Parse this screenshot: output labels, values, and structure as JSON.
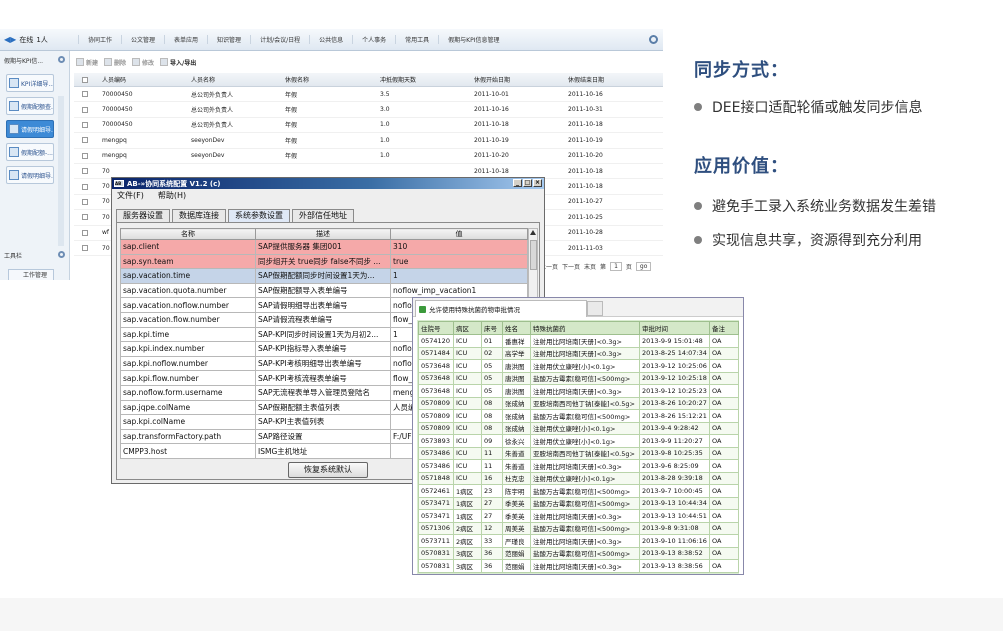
{
  "app": {
    "online_label": "在线",
    "online_count": "1人",
    "menu": [
      "协同工作",
      "公文管理",
      "表单应用",
      "知识管理",
      "计划/会议/日程",
      "公共信息",
      "个人事务",
      "常用工具",
      "假期与KPI信息管理"
    ],
    "sidebar_title": "假期与KPI信...",
    "sidebar_items": [
      "KPI详细导...",
      "假期配额查...",
      "请假明细导...",
      "假期配额-...",
      "请假明细导..."
    ],
    "sidebar_tool_title": "工具栏",
    "sidebar_work": "工作管理",
    "toolbar": [
      "新建",
      "删除",
      "修改",
      "导入/导出"
    ],
    "grid_headers": [
      "人员编码",
      "人员名称",
      "休假名称",
      "冲抵假期天数",
      "休假开始日期",
      "休假结束日期"
    ],
    "grid_rows": [
      [
        "70000450",
        "总公司外负责人",
        "年假",
        "3.5",
        "2011-10-01",
        "2011-10-16"
      ],
      [
        "70000450",
        "总公司外负责人",
        "年假",
        "3.0",
        "2011-10-16",
        "2011-10-31"
      ],
      [
        "70000450",
        "总公司外负责人",
        "年假",
        "1.0",
        "2011-10-18",
        "2011-10-18"
      ],
      [
        "mengpq",
        "seeyonDev",
        "年假",
        "1.0",
        "2011-10-19",
        "2011-10-19"
      ],
      [
        "mengpq",
        "seeyonDev",
        "年假",
        "1.0",
        "2011-10-20",
        "2011-10-20"
      ],
      [
        "70",
        "",
        "",
        "",
        "2011-10-18",
        "2011-10-18"
      ],
      [
        "70",
        "",
        "",
        "",
        "",
        "2011-10-18"
      ],
      [
        "70",
        "",
        "",
        "",
        "",
        "2011-10-27"
      ],
      [
        "70",
        "",
        "",
        "",
        "",
        "2011-10-25"
      ],
      [
        "wf",
        "",
        "",
        "",
        "",
        "2011-10-28"
      ],
      [
        "70",
        "",
        "",
        "",
        "",
        "2011-11-03"
      ]
    ],
    "pager": [
      "上一页",
      "下一页",
      "末页",
      "第",
      "1",
      "页",
      "go"
    ]
  },
  "right": {
    "heading1": "同步方式：",
    "bullet1": "DEE接口适配轮循或触发同步信息",
    "heading2": "应用价值：",
    "bullet2": "避免手工录入系统业务数据发生差错",
    "bullet3": "实现信息共享，资源得到充分利用"
  },
  "dialog": {
    "logo": "AB",
    "title": "AB-»协同系统配置 V1.2 (c)",
    "menu": [
      "文件(F)",
      "帮助(H)"
    ],
    "tabs": [
      "服务器设置",
      "数据库连接",
      "系统参数设置",
      "外部信任地址"
    ],
    "active_tab": "系统参数设置",
    "headers": [
      "名称",
      "描述",
      "值"
    ],
    "rows": [
      {
        "name": "sap.client",
        "desc": "SAP提供服务器 集团001",
        "val": "310",
        "hl": "red"
      },
      {
        "name": "sap.syn.team",
        "desc": "同步组开关 true同步 false不同步 ...",
        "val": "true",
        "hl": "red"
      },
      {
        "name": "sap.vacation.time",
        "desc": "SAP假期配额同步时间设置1天为...",
        "val": "1",
        "hl": "blue"
      },
      {
        "name": "sap.vacation.quota.number",
        "desc": "SAP假期配额导入表单编号",
        "val": "noflow_imp_vacation1",
        "hl": ""
      },
      {
        "name": "sap.vacation.noflow.number",
        "desc": "SAP请假明细导出表单编号",
        "val": "noflow",
        "hl": ""
      },
      {
        "name": "sap.vacation.flow.number",
        "desc": "SAP请假流程表单编号",
        "val": "flow_",
        "hl": ""
      },
      {
        "name": "sap.kpi.time",
        "desc": "SAP-KPI同步时间设置1天为月初2...",
        "val": "1",
        "hl": ""
      },
      {
        "name": "sap.kpi.index.number",
        "desc": "SAP-KPI指标导入表单编号",
        "val": "noflo",
        "hl": ""
      },
      {
        "name": "sap.kpi.noflow.number",
        "desc": "SAP-KPI考核明细导出表单编号",
        "val": "noflo",
        "hl": ""
      },
      {
        "name": "sap.kpi.flow.number",
        "desc": "SAP-KPI考核流程表单编号",
        "val": "flow_",
        "hl": ""
      },
      {
        "name": "sap.noflow.form.username",
        "desc": "SAP无流程表单导入管理员登陆名",
        "val": "meng",
        "hl": ""
      },
      {
        "name": "sap.jqpe.colName",
        "desc": "SAP假期配额主表值列表",
        "val": "人员编",
        "hl": ""
      },
      {
        "name": "sap.kpi.colName",
        "desc": "SAP-KPI主表值列表",
        "val": "",
        "hl": ""
      },
      {
        "name": "sap.transformFactory.path",
        "desc": "SAP路径设置",
        "val": "F:/UF",
        "hl": ""
      },
      {
        "name": "CMPP3.host",
        "desc": "ISMG主机地址",
        "val": "",
        "hl": ""
      }
    ],
    "restore_button": "恢复系统默认"
  },
  "approval": {
    "tab_title": "允许使用特殊抗菌药物审批情况",
    "headers": [
      "住院号",
      "病区",
      "床号",
      "姓名",
      "特殊抗菌药",
      "审批时间",
      "备注"
    ],
    "rows": [
      [
        "0574120",
        "ICU",
        "01",
        "番惠祥",
        "注射用比阿培南[天册]<0.3g>",
        "2013-9-9 15:01:48",
        "OA"
      ],
      [
        "0571484",
        "ICU",
        "02",
        "高学举",
        "注射用比阿培南[天册]<0.3g>",
        "2013-8-25 14:07:34",
        "OA"
      ],
      [
        "0573648",
        "ICU",
        "05",
        "唐洪图",
        "注射用伏立康唑[小]<0.1g>",
        "2013-9-12 10:25:06",
        "OA"
      ],
      [
        "0573648",
        "ICU",
        "05",
        "唐洪图",
        "盐酸万古霉素[稳可信]<500mg>",
        "2013-9-12 10:25:18",
        "OA"
      ],
      [
        "0573648",
        "ICU",
        "05",
        "唐洪图",
        "注射用比阿培南[天册]<0.3g>",
        "2013-9-12 10:25:23",
        "OA"
      ],
      [
        "0570809",
        "ICU",
        "08",
        "张成纳",
        "亚胺培南西司他丁钠[泰能]<0.5g>",
        "2013-8-26 10:20:27",
        "OA"
      ],
      [
        "0570809",
        "ICU",
        "08",
        "张成纳",
        "盐酸万古霉素[稳可信]<500mg>",
        "2013-8-26 15:12:21",
        "OA"
      ],
      [
        "0570809",
        "ICU",
        "08",
        "张成纳",
        "注射用伏立康唑[小]<0.1g>",
        "2013-9-4 9:28:42",
        "OA"
      ],
      [
        "0573893",
        "ICU",
        "09",
        "徐永兴",
        "注射用伏立康唑[小]<0.1g>",
        "2013-9-9 11:20:27",
        "OA"
      ],
      [
        "0573486",
        "ICU",
        "11",
        "朱善道",
        "亚胺培南西司他丁钠[泰能]<0.5g>",
        "2013-9-8 10:25:35",
        "OA"
      ],
      [
        "0573486",
        "ICU",
        "11",
        "朱善道",
        "注射用比阿培南[天册]<0.3g>",
        "2013-9-6 8:25:09",
        "OA"
      ],
      [
        "0571848",
        "ICU",
        "16",
        "杜克忠",
        "注射用伏立康唑[小]<0.1g>",
        "2013-8-28 9:39:18",
        "OA"
      ],
      [
        "0572461",
        "1病区",
        "23",
        "陈宇明",
        "盐酸万古霉素[稳可信]<500mg>",
        "2013-9-7 10:00:45",
        "OA"
      ],
      [
        "0573471",
        "1病区",
        "27",
        "季美英",
        "盐酸万古霉素[稳可信]<500mg>",
        "2013-9-13 10:44:34",
        "OA"
      ],
      [
        "0573471",
        "1病区",
        "27",
        "季美英",
        "注射用比阿培南[天册]<0.3g>",
        "2013-9-13 10:44:51",
        "OA"
      ],
      [
        "0571306",
        "2病区",
        "12",
        "周美英",
        "盐酸万古霉素[稳可信]<500mg>",
        "2013-9-8 9:31:08",
        "OA"
      ],
      [
        "0573711",
        "2病区",
        "33",
        "严瑾良",
        "注射用比阿培南[天册]<0.3g>",
        "2013-9-10 11:06:16",
        "OA"
      ],
      [
        "0570831",
        "3病区",
        "36",
        "范丽娟",
        "盐酸万古霉素[稳可信]<500mg>",
        "2013-9-13 8:38:52",
        "OA"
      ],
      [
        "0570831",
        "3病区",
        "36",
        "范丽娟",
        "注射用比阿培南[天册]<0.3g>",
        "2013-9-13 8:38:56",
        "OA"
      ]
    ]
  }
}
